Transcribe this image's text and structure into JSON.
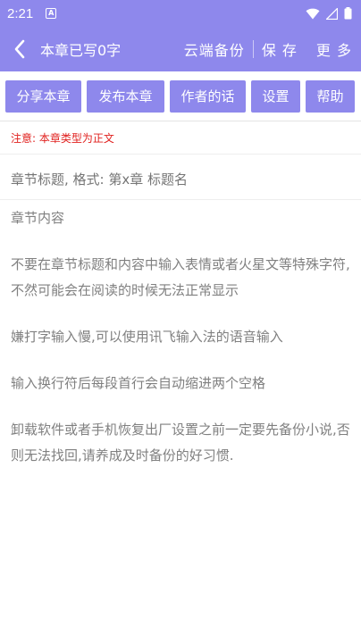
{
  "status_bar": {
    "time": "2:21",
    "app_badge": "A"
  },
  "app_bar": {
    "title": "本章已写0字",
    "actions": [
      "云端备份",
      "保 存",
      "更 多"
    ]
  },
  "toolbar": {
    "buttons": [
      "分享本章",
      "发布本章",
      "作者的话",
      "设置",
      "帮助"
    ]
  },
  "notice": "注意: 本章类型为正文",
  "chapter_title_input": {
    "placeholder": "章节标题, 格式: 第x章 标题名",
    "value": ""
  },
  "content": {
    "placeholder_paragraphs": [
      "章节内容",
      "不要在章节标题和内容中输入表情或者火星文等特殊字符,不然可能会在阅读的时候无法正常显示",
      "嫌打字输入慢,可以使用讯飞输入法的语音输入",
      "输入换行符后每段首行会自动缩进两个空格",
      "卸载软件或者手机恢复出厂设置之前一定要先备份小说,否则无法找回,请养成及时备份的好习惯."
    ]
  },
  "colors": {
    "primary": "#8e88ec",
    "notice": "#e0201e",
    "placeholder_text": "#808080"
  }
}
